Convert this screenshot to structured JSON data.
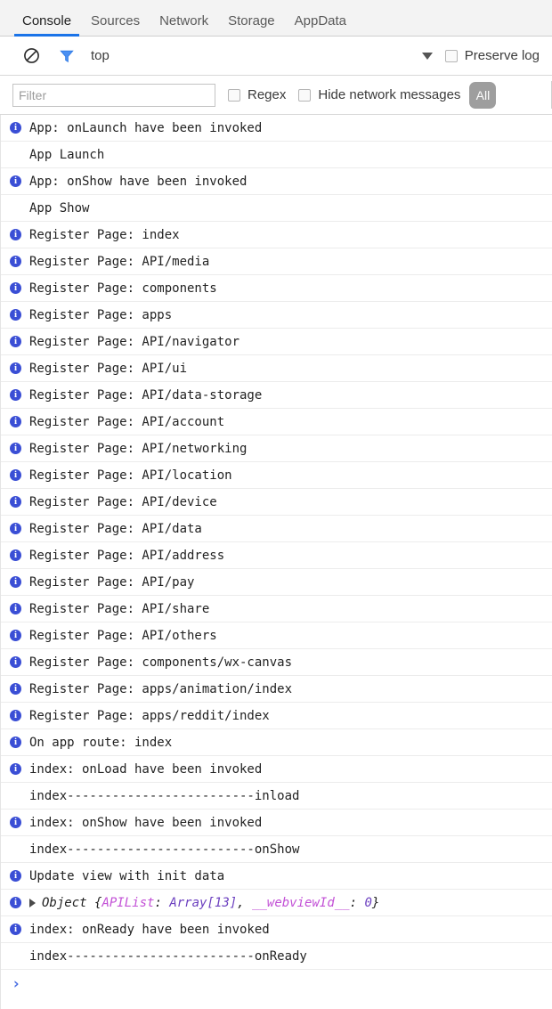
{
  "tabs": [
    {
      "label": "Console",
      "active": true
    },
    {
      "label": "Sources",
      "active": false
    },
    {
      "label": "Network",
      "active": false
    },
    {
      "label": "Storage",
      "active": false
    },
    {
      "label": "AppData",
      "active": false
    }
  ],
  "toolbar": {
    "clear_icon": "clear-console-icon",
    "filter_icon": "filter-funnel-icon",
    "context_value": "top",
    "caret_icon": "chevron-down-icon",
    "preserve_log_label": "Preserve log",
    "preserve_log_checked": false
  },
  "filterbar": {
    "filter_placeholder": "Filter",
    "filter_value": "",
    "regex_label": "Regex",
    "regex_checked": false,
    "hide_network_label": "Hide network messages",
    "hide_network_checked": false,
    "level_button_label": "All"
  },
  "colors": {
    "accent": "#1a73e8",
    "info_icon": "#3a4ed5",
    "object_key": "#c250d6",
    "object_value": "#6b3fbf",
    "level_pill": "#9e9e9e",
    "prompt": "#4a6fe3"
  },
  "console_rows": [
    {
      "icon": true,
      "text": "App: onLaunch have been invoked"
    },
    {
      "icon": false,
      "text": "App Launch"
    },
    {
      "icon": true,
      "text": "App: onShow have been invoked"
    },
    {
      "icon": false,
      "text": "App Show"
    },
    {
      "icon": true,
      "text": "Register Page: index"
    },
    {
      "icon": true,
      "text": "Register Page: API/media"
    },
    {
      "icon": true,
      "text": "Register Page: components"
    },
    {
      "icon": true,
      "text": "Register Page: apps"
    },
    {
      "icon": true,
      "text": "Register Page: API/navigator"
    },
    {
      "icon": true,
      "text": "Register Page: API/ui"
    },
    {
      "icon": true,
      "text": "Register Page: API/data-storage"
    },
    {
      "icon": true,
      "text": "Register Page: API/account"
    },
    {
      "icon": true,
      "text": "Register Page: API/networking"
    },
    {
      "icon": true,
      "text": "Register Page: API/location"
    },
    {
      "icon": true,
      "text": "Register Page: API/device"
    },
    {
      "icon": true,
      "text": "Register Page: API/data"
    },
    {
      "icon": true,
      "text": "Register Page: API/address"
    },
    {
      "icon": true,
      "text": "Register Page: API/pay"
    },
    {
      "icon": true,
      "text": "Register Page: API/share"
    },
    {
      "icon": true,
      "text": "Register Page: API/others"
    },
    {
      "icon": true,
      "text": "Register Page: components/wx-canvas"
    },
    {
      "icon": true,
      "text": "Register Page: apps/animation/index"
    },
    {
      "icon": true,
      "text": "Register Page: apps/reddit/index"
    },
    {
      "icon": true,
      "text": "On app route: index"
    },
    {
      "icon": true,
      "text": "index: onLoad have been invoked"
    },
    {
      "icon": false,
      "text": "index-------------------------inload"
    },
    {
      "icon": true,
      "text": "index: onShow have been invoked"
    },
    {
      "icon": false,
      "text": "index-------------------------onShow"
    },
    {
      "icon": true,
      "text": "Update view with init data"
    }
  ],
  "object_row": {
    "icon": true,
    "expander_icon": "triangle-right-icon",
    "constructor": "Object",
    "open_brace": " {",
    "key1": "APIList",
    "sep1": ": ",
    "value1": "Array[13]",
    "comma": ", ",
    "key2": "__webviewId__",
    "sep2": ": ",
    "value2": "0",
    "close_brace": "}"
  },
  "console_rows_tail": [
    {
      "icon": true,
      "text": "index: onReady have been invoked"
    },
    {
      "icon": false,
      "text": "index-------------------------onReady"
    }
  ],
  "prompt": {
    "chevron": "›"
  }
}
